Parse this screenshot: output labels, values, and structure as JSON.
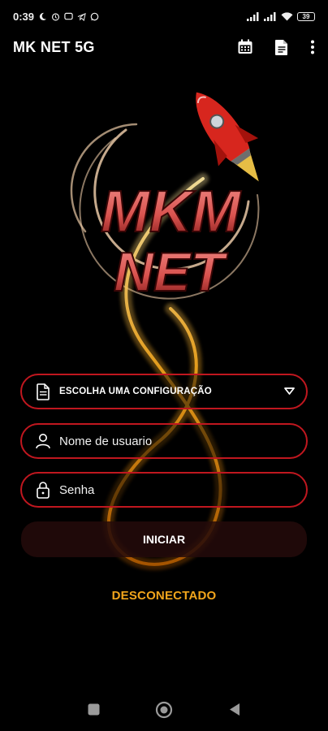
{
  "status_bar": {
    "time": "0:39",
    "battery": "39"
  },
  "app_bar": {
    "title": "MK NET 5G"
  },
  "logo": {
    "line1": "MKM",
    "line2": "NET"
  },
  "form": {
    "config_select": {
      "selected": "ESCOLHA UMA CONFIGURAÇÃO"
    },
    "username": {
      "placeholder": "Nome de usuario",
      "value": ""
    },
    "password": {
      "placeholder": "Senha",
      "value": ""
    },
    "start_label": "INICIAR"
  },
  "connection_status": "DESCONECTADO",
  "colors": {
    "background": "#000000",
    "field_border": "#c0171f",
    "status": "#f2a51c",
    "logo_text": "#d9534f"
  }
}
